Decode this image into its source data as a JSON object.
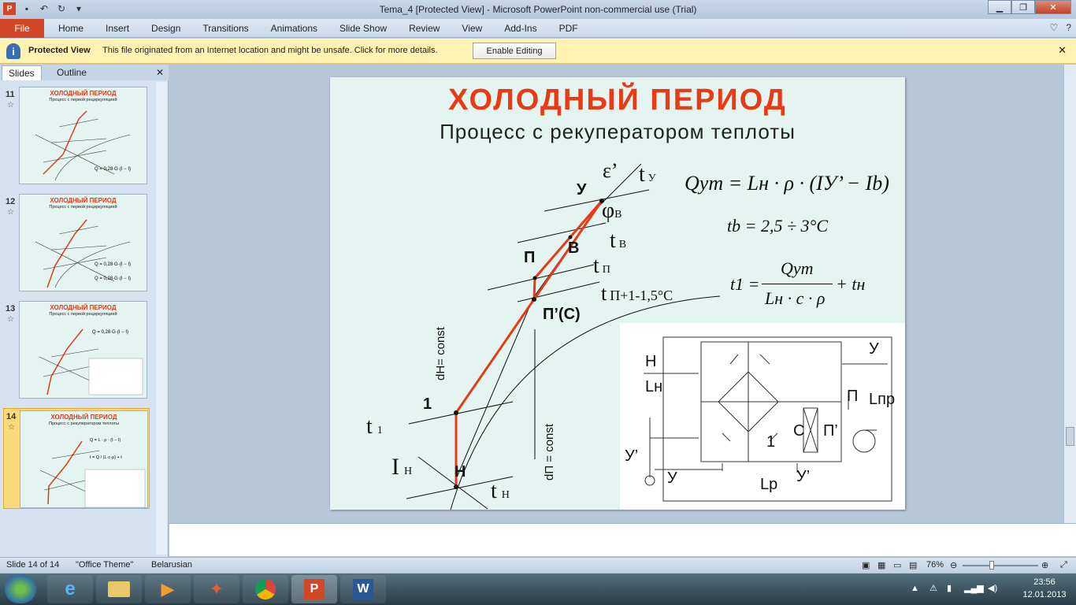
{
  "window": {
    "title": "Tema_4 [Protected View] - Microsoft PowerPoint non-commercial use (Trial)",
    "app_icon": "P"
  },
  "ribbon": {
    "file_label": "File",
    "tabs": [
      "Home",
      "Insert",
      "Design",
      "Transitions",
      "Animations",
      "Slide Show",
      "Review",
      "View",
      "Add-Ins",
      "PDF"
    ]
  },
  "protected_bar": {
    "title": "Protected View",
    "message": "This file originated from an Internet location and might be unsafe. Click for more details.",
    "button": "Enable Editing"
  },
  "left_pane": {
    "tabs": [
      "Slides",
      "Outline"
    ],
    "thumbnails": [
      {
        "number": "11",
        "title": "ХОЛОДНЫЙ ПЕРИОД",
        "subtitle": "Процесс с первой рециркуляцией",
        "selected": false
      },
      {
        "number": "12",
        "title": "ХОЛОДНЫЙ ПЕРИОД",
        "subtitle": "Процесс с первой рециркуляцией",
        "selected": false
      },
      {
        "number": "13",
        "title": "ХОЛОДНЫЙ ПЕРИОД",
        "subtitle": "Процесс с первой рециркуляцией",
        "selected": false
      },
      {
        "number": "14",
        "title": "ХОЛОДНЫЙ ПЕРИОД",
        "subtitle": "Процесс с рекуператором теплоты",
        "selected": true
      }
    ]
  },
  "slide": {
    "title": "ХОЛОДНЫЙ ПЕРИОД",
    "subtitle": "Процесс с рекуператором теплоты",
    "labels": {
      "Y": "У",
      "eps": "ε’",
      "tY": "t",
      "tY_sub": "У",
      "phi": "φ",
      "phi_sub": "В",
      "B": "В",
      "tB": "t",
      "tB_sub": "В",
      "P": "П",
      "tP": "t",
      "tP_sub": "П",
      "tP2": "t",
      "tP2_sub": "П+1-1,5°С",
      "PC": "П’(С)",
      "one": "1",
      "t1": "t",
      "t1_sub": "1",
      "IH": "I",
      "IH_sub": "Н",
      "H": "Н",
      "tH": "t",
      "tH_sub": "Н",
      "dH_left": "dН= const",
      "dH_right": "dП = const"
    },
    "formulas": {
      "f1": "Qут = Lн · ρ · (IУ’ − Ib)",
      "f2": "tb = 2,5 ÷ 3°C",
      "f3_left": "t1 =",
      "f3_num": "Qут",
      "f3_den": "Lн · c · ρ",
      "f3_right": "+ tн"
    },
    "diagram_labels": {
      "H": "Н",
      "LH": "Lн",
      "Y_top": "У",
      "P": "П",
      "Lpr": "Lпр",
      "C": "С",
      "P2": "П’",
      "one": "1",
      "Y2": "У’",
      "Y_bottom": "У",
      "Lp": "Lр",
      "Y3": "У’"
    }
  },
  "status_bar": {
    "slide": "Slide 14 of 14",
    "theme": "\"Office Theme\"",
    "language": "Belarusian",
    "zoom": "76%"
  },
  "tray": {
    "time": "23:56",
    "date": "12.01.2013"
  },
  "colors": {
    "accent": "#e83a15",
    "slide_bg": "#e4f4f1",
    "selected_thumb": "#fbd87b"
  }
}
